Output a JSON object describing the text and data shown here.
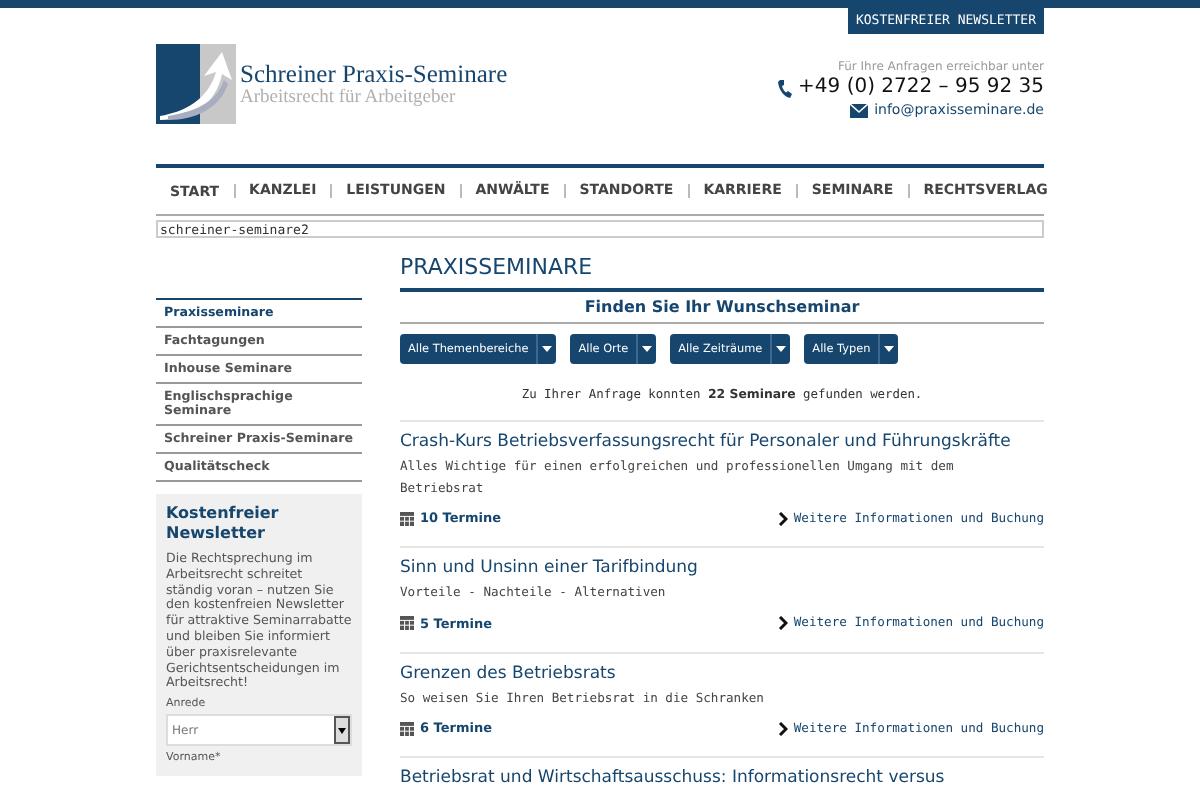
{
  "top_bar": {
    "newsletter_link": "KOSTENFREIER NEWSLETTER"
  },
  "header": {
    "logo_title": "Schreiner Praxis-Seminare",
    "logo_subtitle": "Arbeitsrecht für Arbeitgeber",
    "contact_hint": "Für Ihre Anfragen erreichbar unter",
    "phone": "+49 (0) 2722 – 95 92 35",
    "email": "info@praxisseminare.de"
  },
  "nav": [
    "START",
    "KANZLEI",
    "LEISTUNGEN",
    "ANWÄLTE",
    "STANDORTE",
    "KARRIERE",
    "SEMINARE",
    "RECHTSVERLAG"
  ],
  "path_field": {
    "value": "schreiner-seminare2"
  },
  "sidebar": {
    "items": [
      {
        "label": "Praxisseminare",
        "selected": true
      },
      {
        "label": "Fachtagungen",
        "selected": false
      },
      {
        "label": "Inhouse Seminare",
        "selected": false
      },
      {
        "label": "Englischsprachige Seminare",
        "selected": false
      },
      {
        "label": "Schreiner Praxis-Seminare",
        "selected": false
      },
      {
        "label": "Qualitätscheck",
        "selected": false
      }
    ],
    "newsletter": {
      "title": "Kostenfreier Newsletter",
      "text": "Die Rechtsprechung im Arbeitsrecht schreitet ständig voran – nutzen Sie den kostenfreien Newsletter für attraktive Seminarrabatte und bleiben Sie informiert über praxisrelevante Gerichtsentscheidungen im Arbeitsrecht!",
      "salutation_label": "Anrede",
      "salutation_value": "Herr",
      "firstname_label": "Vorname*"
    }
  },
  "main": {
    "title": "PRAXISSEMINARE",
    "finder_title": "Finden Sie Ihr Wunschseminar",
    "filters": [
      "Alle Themenbereiche",
      "Alle Orte",
      "Alle Zeiträume",
      "Alle Typen"
    ],
    "result_text": "Zu Ihrer Anfrage konnten **22 Seminare** gefunden werden.",
    "seminars": [
      {
        "title": "Crash-Kurs Betriebsverfassungsrecht für Personaler und Führungskräfte",
        "subtitle": "Alles Wichtige für einen erfolgreichen und professionellen Umgang mit dem Betriebsrat",
        "dates": "10 Termine",
        "link": "Weitere Informationen und Buchung"
      },
      {
        "title": "Sinn und Unsinn einer Tarifbindung",
        "subtitle": "Vorteile - Nachteile - Alternativen",
        "dates": "5 Termine",
        "link": "Weitere Informationen und Buchung"
      },
      {
        "title": "Grenzen des Betriebsrats",
        "subtitle": "So weisen Sie Ihren Betriebsrat in die Schranken",
        "dates": "6 Termine",
        "link": "Weitere Informationen und Buchung"
      },
      {
        "title": "Betriebsrat und Wirtschaftsausschuss: Informationsrecht versus"
      }
    ]
  }
}
